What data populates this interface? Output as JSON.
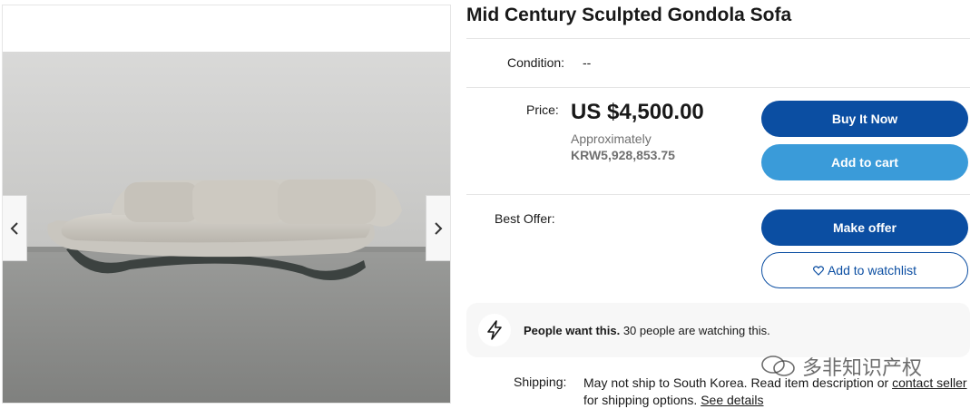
{
  "gallery": {
    "prev_icon": "chevron-left-icon",
    "next_icon": "chevron-right-icon"
  },
  "listing": {
    "title": "Mid Century Sculpted Gondola Sofa",
    "condition_label": "Condition:",
    "condition_value": "--",
    "price_label": "Price:",
    "price": "US $4,500.00",
    "approx_label": "Approximately",
    "approx_value": "KRW5,928,853.75",
    "best_offer_label": "Best Offer:"
  },
  "actions": {
    "buy_now": "Buy It Now",
    "add_to_cart": "Add to cart",
    "make_offer": "Make offer",
    "watchlist": "Add to watchlist",
    "watchlist_icon": "heart-icon"
  },
  "banner": {
    "icon": "lightning-icon",
    "bold": "People want this.",
    "text": "30 people are watching this."
  },
  "shipping": {
    "label": "Shipping:",
    "text_1": "May not ship to South Korea. Read item description or",
    "link_contact": "contact seller",
    "text_2": "for shipping options.",
    "link_details": "See details"
  },
  "watermark": {
    "text": "多非知识产权"
  },
  "colors": {
    "primary_blue": "#0b4ea2",
    "secondary_blue": "#3a9bd9"
  }
}
